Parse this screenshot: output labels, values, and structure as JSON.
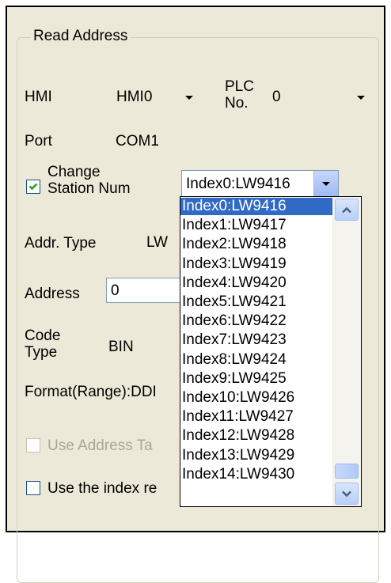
{
  "group": {
    "title": "Read Address"
  },
  "hmi": {
    "label": "HMI",
    "value": "HMI0"
  },
  "plc": {
    "label": "PLC\nNo.",
    "value": "0"
  },
  "port": {
    "label": "Port",
    "value": "COM1"
  },
  "change_station": {
    "label": "Change\nStation Num",
    "checked": true,
    "value": "Index0:LW9416"
  },
  "addr_type": {
    "label": "Addr. Type",
    "value": "LW"
  },
  "address": {
    "label": "Address",
    "value": "0"
  },
  "code_type": {
    "label": "Code\nType",
    "value": "BIN"
  },
  "format": {
    "label": "Format(Range):DDI"
  },
  "use_address_tag": {
    "label": "Use Address Ta",
    "checked": false,
    "enabled": false
  },
  "use_index": {
    "label": "Use the index re",
    "checked": false
  },
  "dropdown": {
    "selected_index": 0,
    "options": [
      "Index0:LW9416",
      "Index1:LW9417",
      "Index2:LW9418",
      "Index3:LW9419",
      "Index4:LW9420",
      "Index5:LW9421",
      "Index6:LW9422",
      "Index7:LW9423",
      "Index8:LW9424",
      "Index9:LW9425",
      "Index10:LW9426",
      "Index11:LW9427",
      "Index12:LW9428",
      "Index13:LW9429",
      "Index14:LW9430"
    ]
  },
  "colors": {
    "selection": "#316ac5",
    "panel_bg": "#ece9d8",
    "scroll_arrow": "#4d6185"
  }
}
